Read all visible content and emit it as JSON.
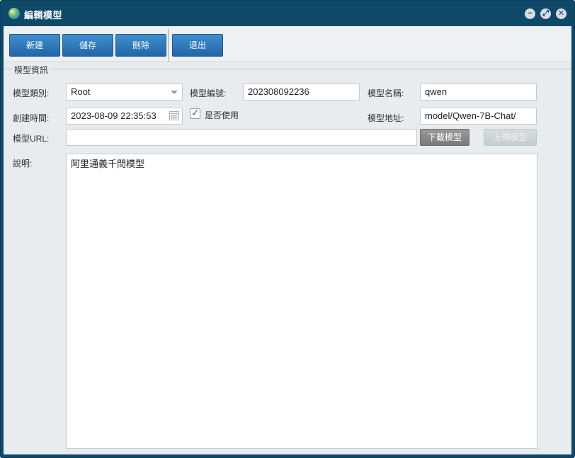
{
  "window": {
    "title": "編輯模型",
    "controls": {
      "minimize": "−",
      "restore": "⤢",
      "close": "✕"
    }
  },
  "toolbar": {
    "new_label": "新建",
    "save_label": "儲存",
    "delete_label": "刪除",
    "exit_label": "退出"
  },
  "form": {
    "section_title": "模型資訊",
    "category": {
      "label": "模型類別:",
      "value": "Root"
    },
    "model_no": {
      "label": "模型編號:",
      "value": "202308092236"
    },
    "model_name": {
      "label": "模型名稱:",
      "value": "qwen"
    },
    "created_time": {
      "label": "創建時間:",
      "value": "2023-08-09 22:35:53"
    },
    "in_use": {
      "label": "是否使用",
      "checked": true
    },
    "model_address": {
      "label": "模型地址:",
      "value": "model/Qwen-7B-Chat/"
    },
    "model_url": {
      "label": "模型URL:",
      "value": ""
    },
    "download_label": "下載模型",
    "upload_label": "上傳模型",
    "description": {
      "label": "說明:",
      "value": "阿里通義千問模型"
    }
  },
  "colors": {
    "titlebar": "#0e4a68",
    "primary_button": "#2a74b8",
    "panel_bg": "#e9ecee"
  }
}
